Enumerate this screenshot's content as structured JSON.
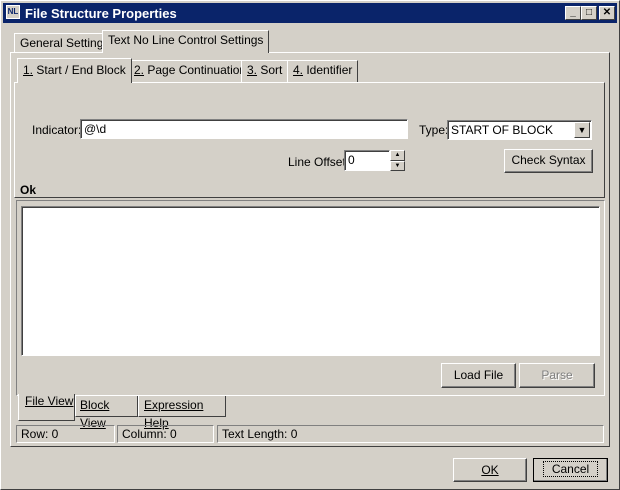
{
  "window": {
    "title": "File Structure Properties",
    "icon": "app-icon"
  },
  "title_buttons": {
    "minimize": "_",
    "maximize": "□",
    "close": "✕"
  },
  "outer_tabs": [
    {
      "label": "General Settings"
    },
    {
      "label": "Text No Line Control Settings"
    }
  ],
  "inner_tabs": [
    {
      "num": "1.",
      "label": " Start / End Block"
    },
    {
      "num": "2.",
      "label": " Page Continuation"
    },
    {
      "num": "3.",
      "label": " Sort"
    },
    {
      "num": "4.",
      "label": " Identifier"
    }
  ],
  "form": {
    "indicator_label": "Indicator:",
    "indicator_value": "@\\d",
    "type_label": "Type:",
    "type_value": "START OF BLOCK",
    "line_offset_label": "Line Offset:",
    "line_offset_value": "0",
    "check_syntax": "Check Syntax",
    "status": "Ok"
  },
  "file_view": {
    "load_file": "Load File",
    "parse": "Parse"
  },
  "bottom_tabs": [
    {
      "label": "File View"
    },
    {
      "label": "Block View"
    },
    {
      "label": "Expression Help"
    }
  ],
  "statusbar": {
    "row": "Row:  0",
    "column": "Column:  0",
    "text_length": "Text Length:  0"
  },
  "dialog_buttons": {
    "ok": "OK",
    "cancel": "Cancel"
  }
}
